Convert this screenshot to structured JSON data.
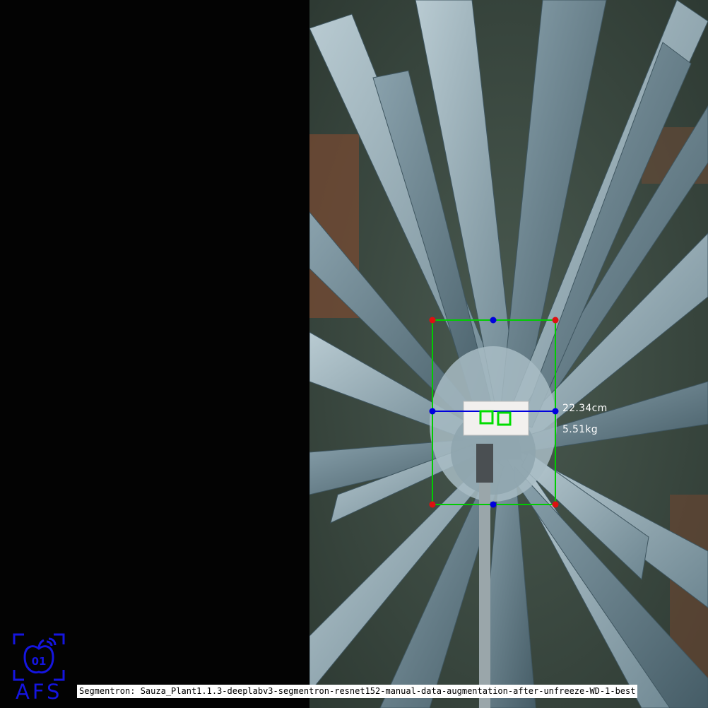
{
  "measurement": {
    "diameter": "22.34cm",
    "weight": "5.51kg"
  },
  "logo": {
    "badge": "01",
    "text": "AFS"
  },
  "caption": "Segmentron: Sauza_Plant1.1.3-deeplabv3-segmentron-resnet152-manual-data-augmentation-after-unfreeze-WD-1-best",
  "colors": {
    "box": "#00cc00",
    "corner": "#dd1111",
    "midpoint": "#0000dd",
    "logo": "#1515e0"
  }
}
